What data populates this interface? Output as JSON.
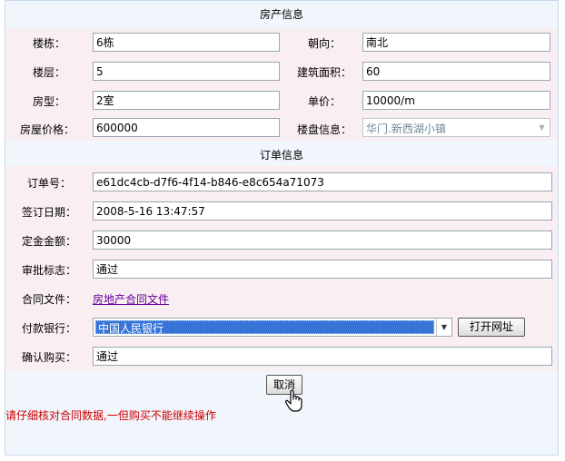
{
  "property": {
    "title": "房产信息",
    "building_label": "楼栋：",
    "building_value": "6栋",
    "orientation_label": "朝向：",
    "orientation_value": "南北",
    "floor_label": "楼层：",
    "floor_value": "5",
    "area_label": "建筑面积：",
    "area_value": "60",
    "type_label": "房型：",
    "type_value": "2室",
    "unit_price_label": "单价：",
    "unit_price_value": "10000/m",
    "price_label": "房屋价格：",
    "price_value": "600000",
    "estate_label": "楼盘信息：",
    "estate_value": "华门.新西湖小镇"
  },
  "order": {
    "title": "订单信息",
    "order_no_label": "订单号：",
    "order_no_value": "e61dc4cb-d7f6-4f14-b846-e8c654a71073",
    "sign_date_label": "签订日期：",
    "sign_date_value": "2008-5-16 13:47:57",
    "deposit_label": "定金金额：",
    "deposit_value": "30000",
    "approval_label": "审批标志：",
    "approval_value": "通过",
    "contract_label": "合同文件：",
    "contract_link": "房地产合同文件",
    "bank_label": "付款银行：",
    "bank_value": "中国人民银行",
    "open_url_button": "打开网址",
    "confirm_label": "确认购买：",
    "confirm_value": "通过"
  },
  "actions": {
    "cancel_button": "取消"
  },
  "warning": "请仔细核对合同数据,一但购买不能继续操作"
}
